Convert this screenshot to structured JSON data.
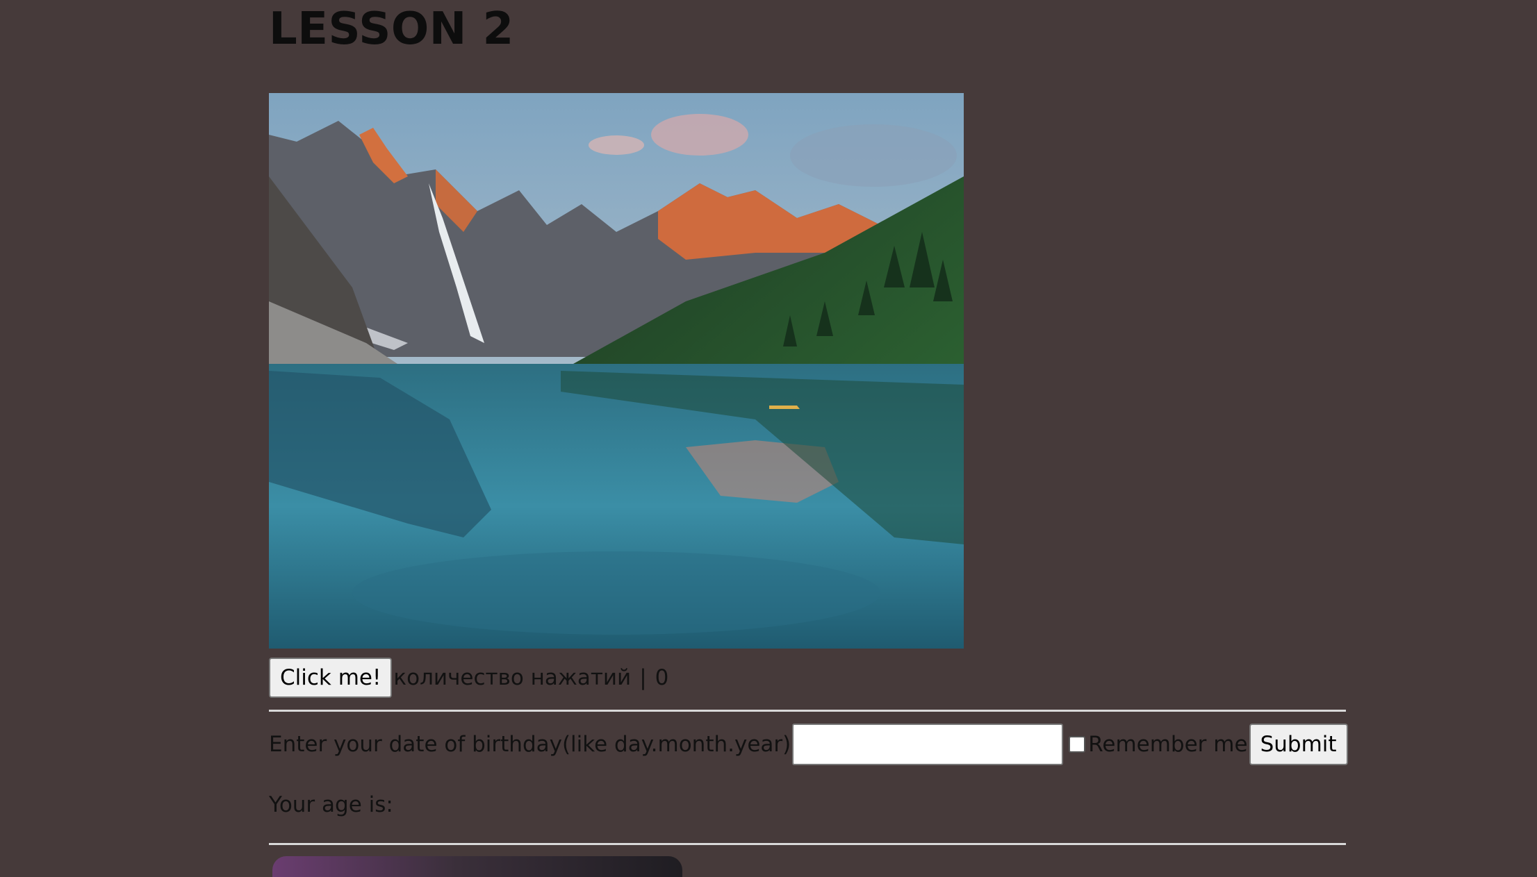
{
  "page": {
    "title": "LESSON 2"
  },
  "image": {
    "subject": "mountain-lake-landscape"
  },
  "click_section": {
    "button_label": "Click me!",
    "counter_label": "количество нажатий",
    "separator": "|",
    "count": "0"
  },
  "birthday_form": {
    "prompt": "Enter your date of birthday(like day.month.year)",
    "input_value": "",
    "remember_label": "Remember me",
    "remember_checked": false,
    "submit_label": "Submit"
  },
  "result": {
    "age_label": "Your age is:"
  },
  "colors": {
    "background": "#463a3a",
    "text": "#111111",
    "divider": "#d9d9d9"
  }
}
